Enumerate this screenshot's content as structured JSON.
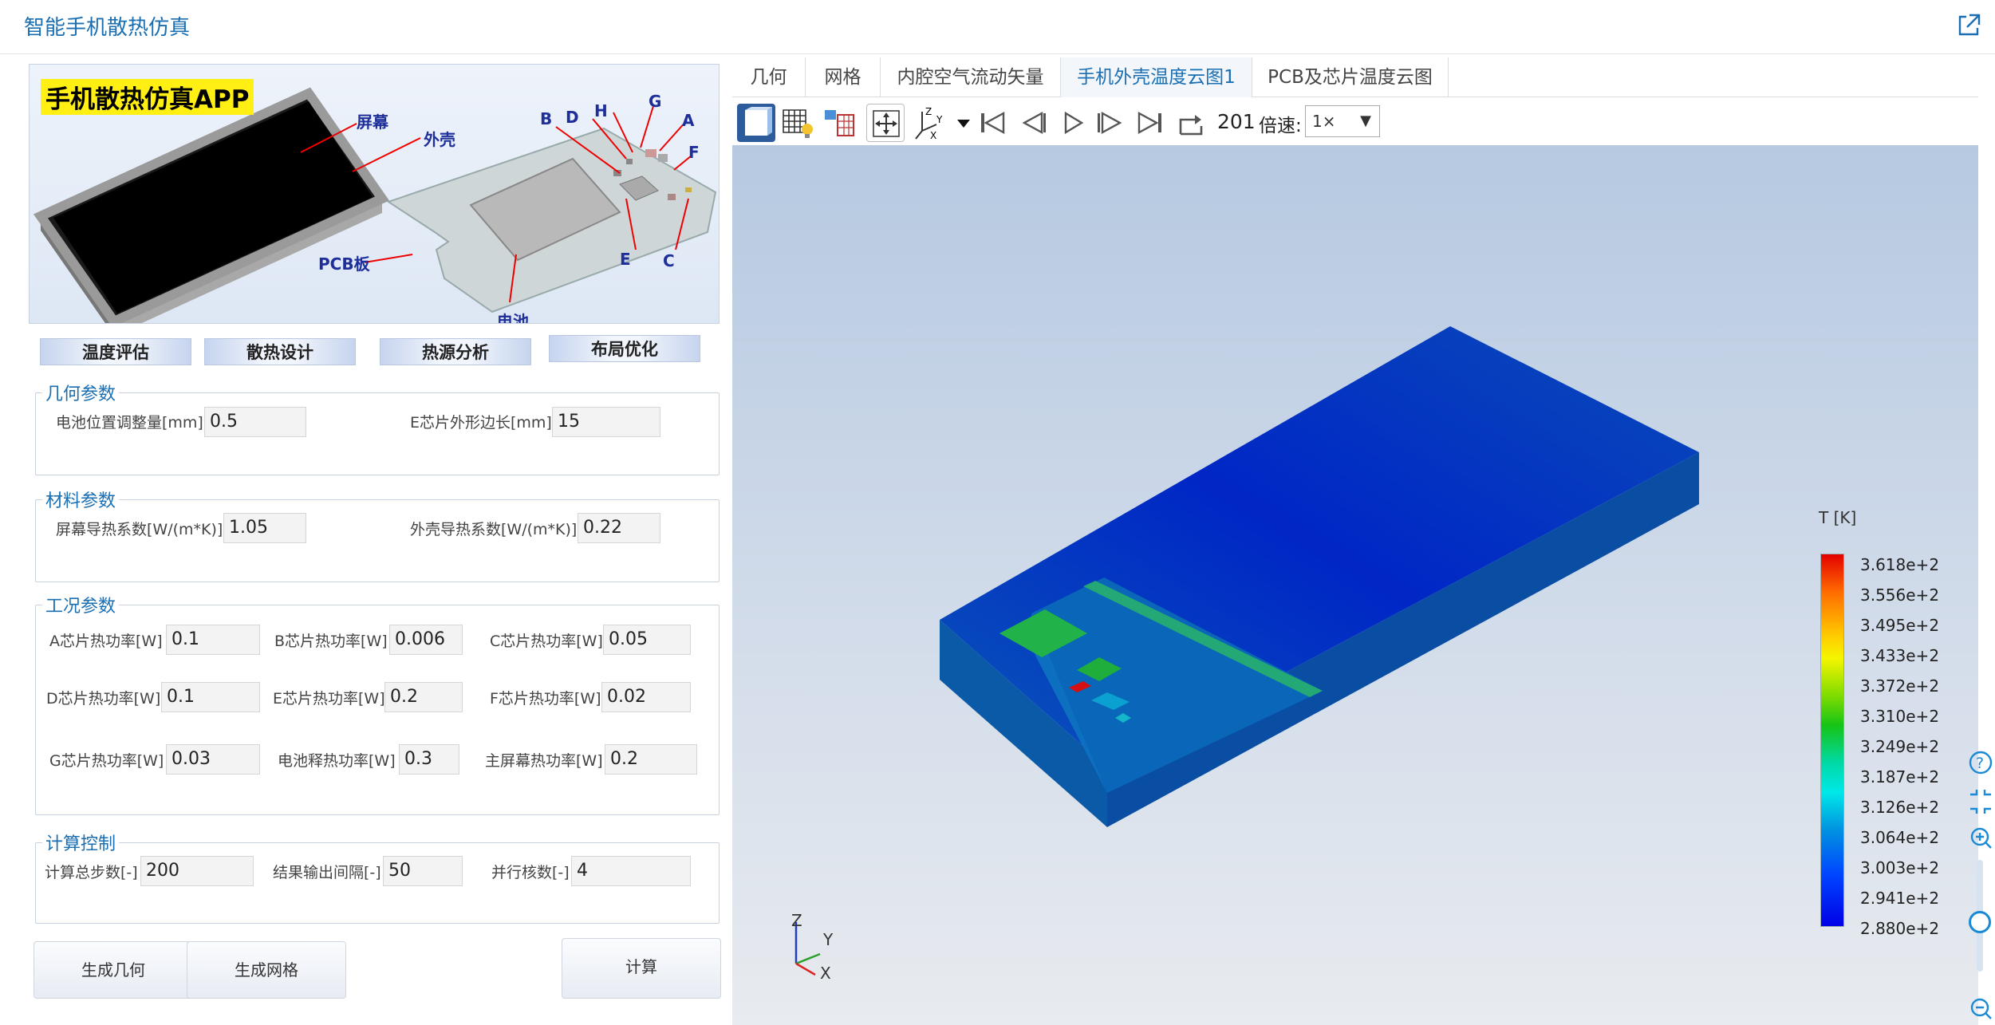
{
  "app": {
    "title": "智能手机散热仿真"
  },
  "banner": {
    "app_name": "手机散热仿真APP",
    "labels": {
      "screen": "屏幕",
      "shell": "外壳",
      "pcb": "PCB板",
      "battery": "电池",
      "a": "A",
      "b": "B",
      "c": "C",
      "d": "D",
      "e": "E",
      "f": "F",
      "g": "G",
      "h": "H"
    },
    "tabs": [
      "温度评估",
      "散热设计",
      "热源分析",
      "布局优化"
    ]
  },
  "geometry": {
    "legend": "几何参数",
    "battery_offset_label": "电池位置调整量[mm]",
    "battery_offset": "0.5",
    "chip_e_side_label": "E芯片外形边长[mm]",
    "chip_e_side": "15"
  },
  "material": {
    "legend": "材料参数",
    "screen_k_label": "屏幕导热系数[W/(m*K)]",
    "screen_k": "1.05",
    "shell_k_label": "外壳导热系数[W/(m*K)]",
    "shell_k": "0.22"
  },
  "conditions": {
    "legend": "工况参数",
    "rows": [
      [
        {
          "label": "A芯片热功率[W]",
          "value": "0.1"
        },
        {
          "label": "B芯片热功率[W]",
          "value": "0.006"
        },
        {
          "label": "C芯片热功率[W]",
          "value": "0.05"
        }
      ],
      [
        {
          "label": "D芯片热功率[W]",
          "value": "0.1"
        },
        {
          "label": "E芯片热功率[W]",
          "value": "0.2"
        },
        {
          "label": "F芯片热功率[W]",
          "value": "0.02"
        }
      ],
      [
        {
          "label": "G芯片热功率[W]",
          "value": "0.03"
        },
        {
          "label": "电池释热功率[W]",
          "value": "0.3"
        },
        {
          "label": "主屏幕热功率[W]",
          "value": "0.2"
        }
      ]
    ]
  },
  "compute": {
    "legend": "计算控制",
    "total_steps_label": "计算总步数[-]",
    "total_steps": "200",
    "output_interval_label": "结果输出间隔[-]",
    "output_interval": "50",
    "cores_label": "并行核数[-]",
    "cores": "4"
  },
  "buttons": {
    "gen_geometry": "生成几何",
    "gen_mesh": "生成网格",
    "compute": "计算"
  },
  "view_tabs": [
    "几何",
    "网格",
    "内腔空气流动矢量",
    "手机外壳温度云图1",
    "PCB及芯片温度云图"
  ],
  "active_view_tab": 3,
  "toolbar": {
    "frame": "201",
    "speed_label": "倍速:",
    "speed": "1×"
  },
  "triad": {
    "x": "X",
    "y": "Y",
    "z": "Z"
  },
  "legend": {
    "title": "T [K]",
    "ticks": [
      "3.618e+2",
      "3.556e+2",
      "3.495e+2",
      "3.433e+2",
      "3.372e+2",
      "3.310e+2",
      "3.249e+2",
      "3.187e+2",
      "3.126e+2",
      "3.064e+2",
      "3.003e+2",
      "2.941e+2",
      "2.880e+2"
    ]
  },
  "colors": {
    "accent": "#1a6fb3",
    "hot": "#e30000",
    "cold": "#0000e6"
  }
}
